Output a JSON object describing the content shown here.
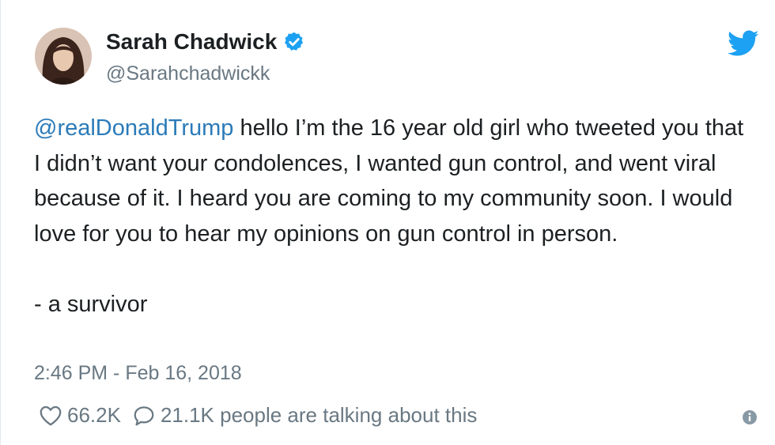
{
  "author": {
    "display_name": "Sarah Chadwick",
    "handle": "@Sarahchadwickk",
    "avatar_icon": "avatar-photo",
    "verified_icon": "verified-badge-icon"
  },
  "brand": {
    "icon": "twitter-bird-icon",
    "color": "#1da1f2"
  },
  "tweet": {
    "mention": "@realDonaldTrump",
    "paragraph_1": " hello I’m the 16 year old girl who tweeted you that I didn’t want your condolences, I wanted gun control, and went viral because of it. I heard you are coming to my community soon. I would love for you to hear my opinions on gun control in person.",
    "paragraph_2": "- a survivor",
    "timestamp": "2:46 PM - Feb 16, 2018"
  },
  "actions": {
    "likes": "66.2K",
    "talking": "21.1K people are talking about this",
    "like_icon": "heart-icon",
    "reply_icon": "speech-bubble-icon",
    "info_icon": "info-icon"
  },
  "colors": {
    "text": "#1c2022",
    "secondary": "#697882",
    "link": "#2b7bb9",
    "verified": "#1da1f2"
  }
}
